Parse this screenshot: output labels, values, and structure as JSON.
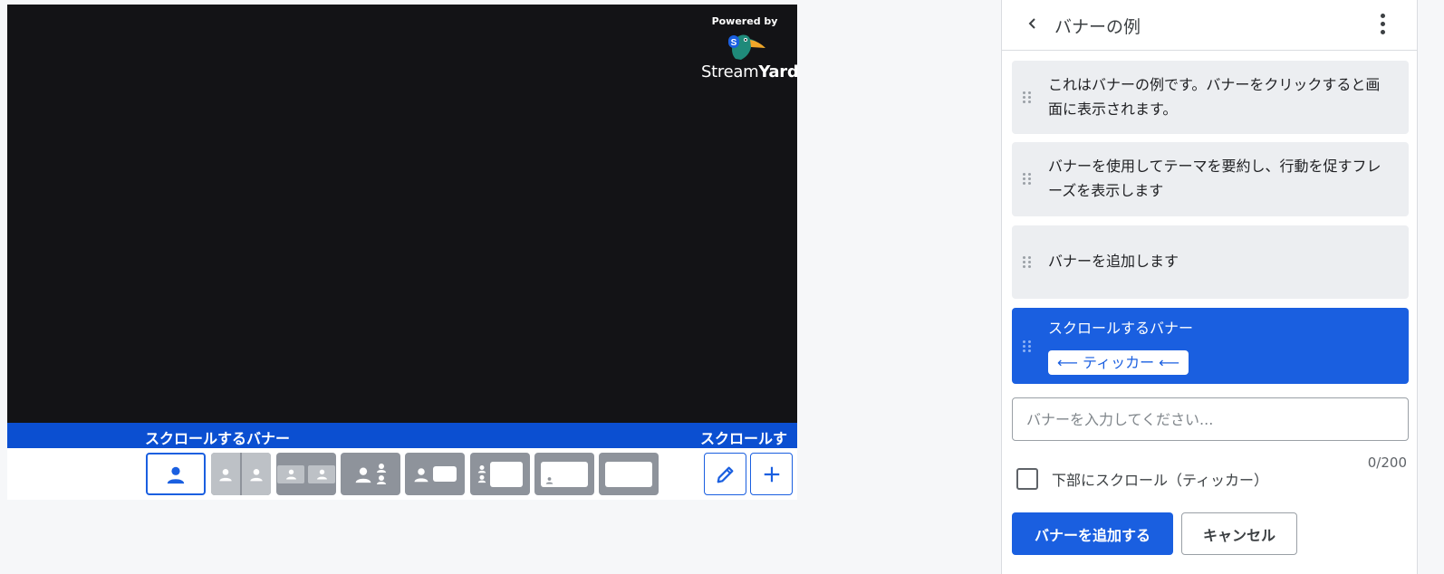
{
  "stage": {
    "branding": {
      "powered_by": "Powered by",
      "name_light": "Stream",
      "name_bold": "Yard",
      "logo_icon": "streamyard-bird-icon"
    },
    "ticker_texts": [
      "スクロールするバナー",
      "スクロールす"
    ],
    "layouts": [
      {
        "name": "solo",
        "active": true
      },
      {
        "name": "split-two"
      },
      {
        "name": "grid-two"
      },
      {
        "name": "person-and-stack"
      },
      {
        "name": "person-and-screen"
      },
      {
        "name": "stack-and-screen"
      },
      {
        "name": "screen-with-pip"
      },
      {
        "name": "screen-only"
      }
    ],
    "tools": {
      "edit_icon": "pencil-icon",
      "add_icon": "plus-icon"
    }
  },
  "panel": {
    "title": "バナーの例",
    "back_icon": "chevron-left-icon",
    "more_icon": "more-vertical-icon",
    "banners": [
      {
        "text": "これはバナーの例です。バナーをクリックすると画面に表示されます。"
      },
      {
        "text": "バナーを使用してテーマを要約し、行動を促すフレーズを表示します"
      },
      {
        "text": "バナーを追加します"
      },
      {
        "text": "スクロールするバナー",
        "chip": "⟵ ティッカー ⟵",
        "selected": true
      }
    ],
    "input": {
      "value": "",
      "placeholder": "バナーを入力してください..."
    },
    "char_count": "0/200",
    "checkbox": {
      "label": "下部にスクロール（ティッカー）",
      "checked": false
    },
    "add_button": "バナーを追加する",
    "cancel_button": "キャンセル"
  },
  "colors": {
    "accent": "#1a5fe0",
    "ticker_bar": "#0b4fd1",
    "canvas": "#131316",
    "layout_gray": "#8e939b"
  }
}
